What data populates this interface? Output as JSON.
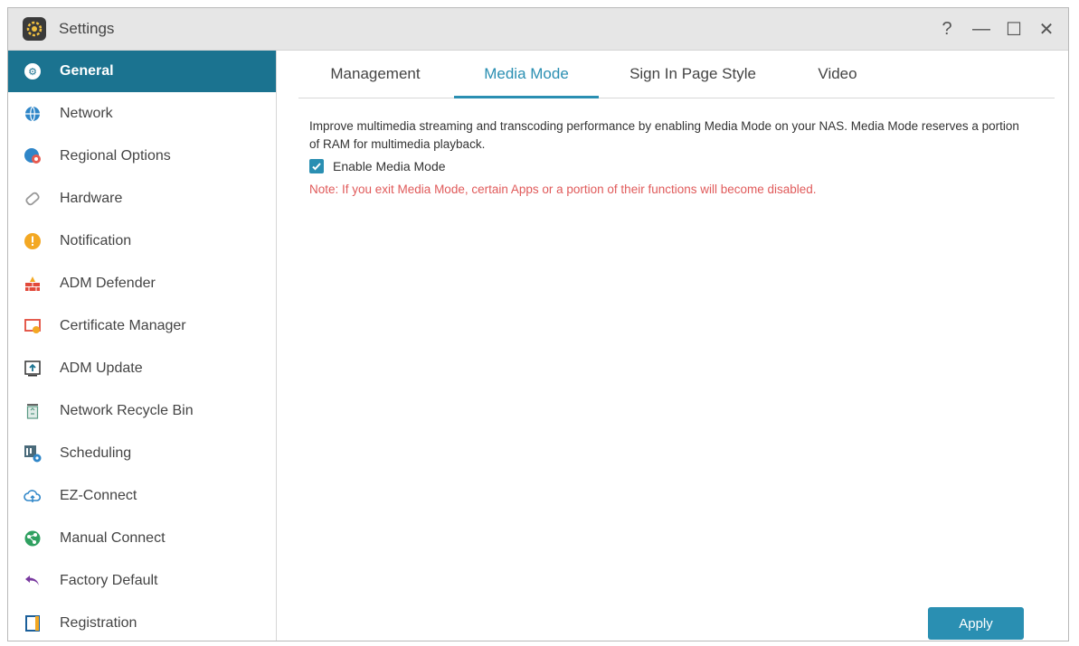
{
  "window": {
    "title": "Settings",
    "controls": {
      "help": "?",
      "minimize": "—",
      "maximize": "☐",
      "close": "✕"
    }
  },
  "sidebar": {
    "items": [
      {
        "label": "General",
        "icon": "general-icon",
        "active": true
      },
      {
        "label": "Network",
        "icon": "globe-icon"
      },
      {
        "label": "Regional Options",
        "icon": "regional-globe-icon"
      },
      {
        "label": "Hardware",
        "icon": "hardware-icon"
      },
      {
        "label": "Notification",
        "icon": "notification-icon"
      },
      {
        "label": "ADM Defender",
        "icon": "firewall-icon"
      },
      {
        "label": "Certificate Manager",
        "icon": "certificate-icon"
      },
      {
        "label": "ADM Update",
        "icon": "update-icon"
      },
      {
        "label": "Network Recycle Bin",
        "icon": "recycle-bin-icon"
      },
      {
        "label": "Scheduling",
        "icon": "scheduling-icon"
      },
      {
        "label": "EZ-Connect",
        "icon": "cloud-connect-icon"
      },
      {
        "label": "Manual Connect",
        "icon": "manual-connect-icon"
      },
      {
        "label": "Factory Default",
        "icon": "undo-icon"
      },
      {
        "label": "Registration",
        "icon": "registration-icon"
      }
    ]
  },
  "tabs": [
    {
      "label": "Management"
    },
    {
      "label": "Media Mode",
      "active": true
    },
    {
      "label": "Sign In Page Style"
    },
    {
      "label": "Video"
    }
  ],
  "media_mode": {
    "description": "Improve multimedia streaming and transcoding performance by enabling Media Mode on your NAS. Media Mode reserves a portion of RAM for multimedia playback.",
    "checkbox_label": "Enable Media Mode",
    "checkbox_checked": true,
    "note": "Note: If you exit Media Mode, certain Apps or a portion of their functions will become disabled."
  },
  "actions": {
    "apply_label": "Apply"
  },
  "colors": {
    "accent": "#2a8fb2",
    "active_sidebar": "#1b7390",
    "note_red": "#e05a5a"
  }
}
